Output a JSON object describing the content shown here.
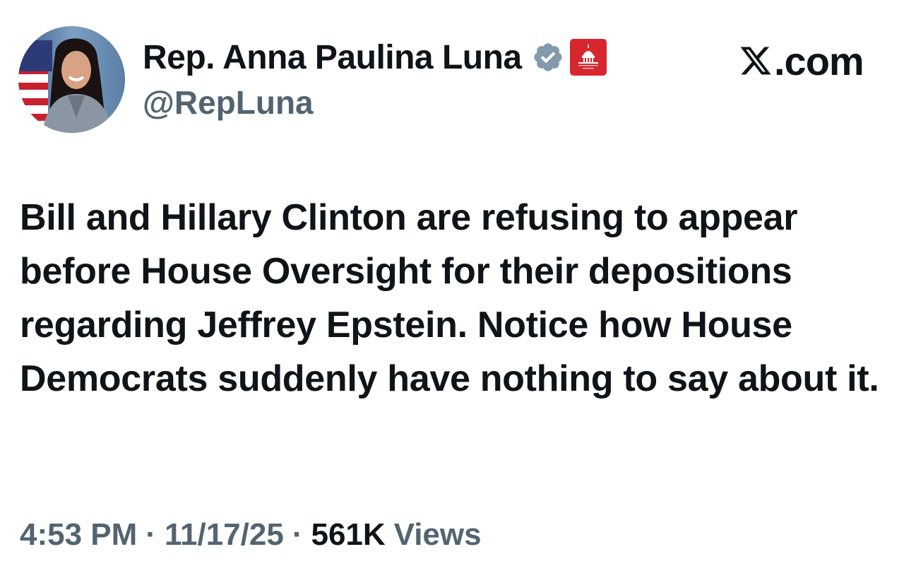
{
  "author": {
    "display_name": "Rep. Anna Paulina Luna",
    "handle": "@RepLuna",
    "verified_icon": "verified-badge-icon",
    "affiliate_icon": "house-gop-capitol-icon",
    "affiliate_label": "HOUSE GOP",
    "verified_color": "#829aab",
    "affiliate_color": "#d8262e"
  },
  "brand": {
    "label": ".com",
    "icon": "x-logo-icon"
  },
  "tweet": {
    "text": "Bill and Hillary Clinton are refusing to appear before House Oversight for their depositions regarding Jeffrey Epstein. Notice how House Democrats suddenly have nothing to say about it."
  },
  "meta": {
    "time": "4:53 PM",
    "separator": "·",
    "date": "11/17/25",
    "views_count": "561K",
    "views_label": "Views",
    "muted_color": "#536471"
  }
}
